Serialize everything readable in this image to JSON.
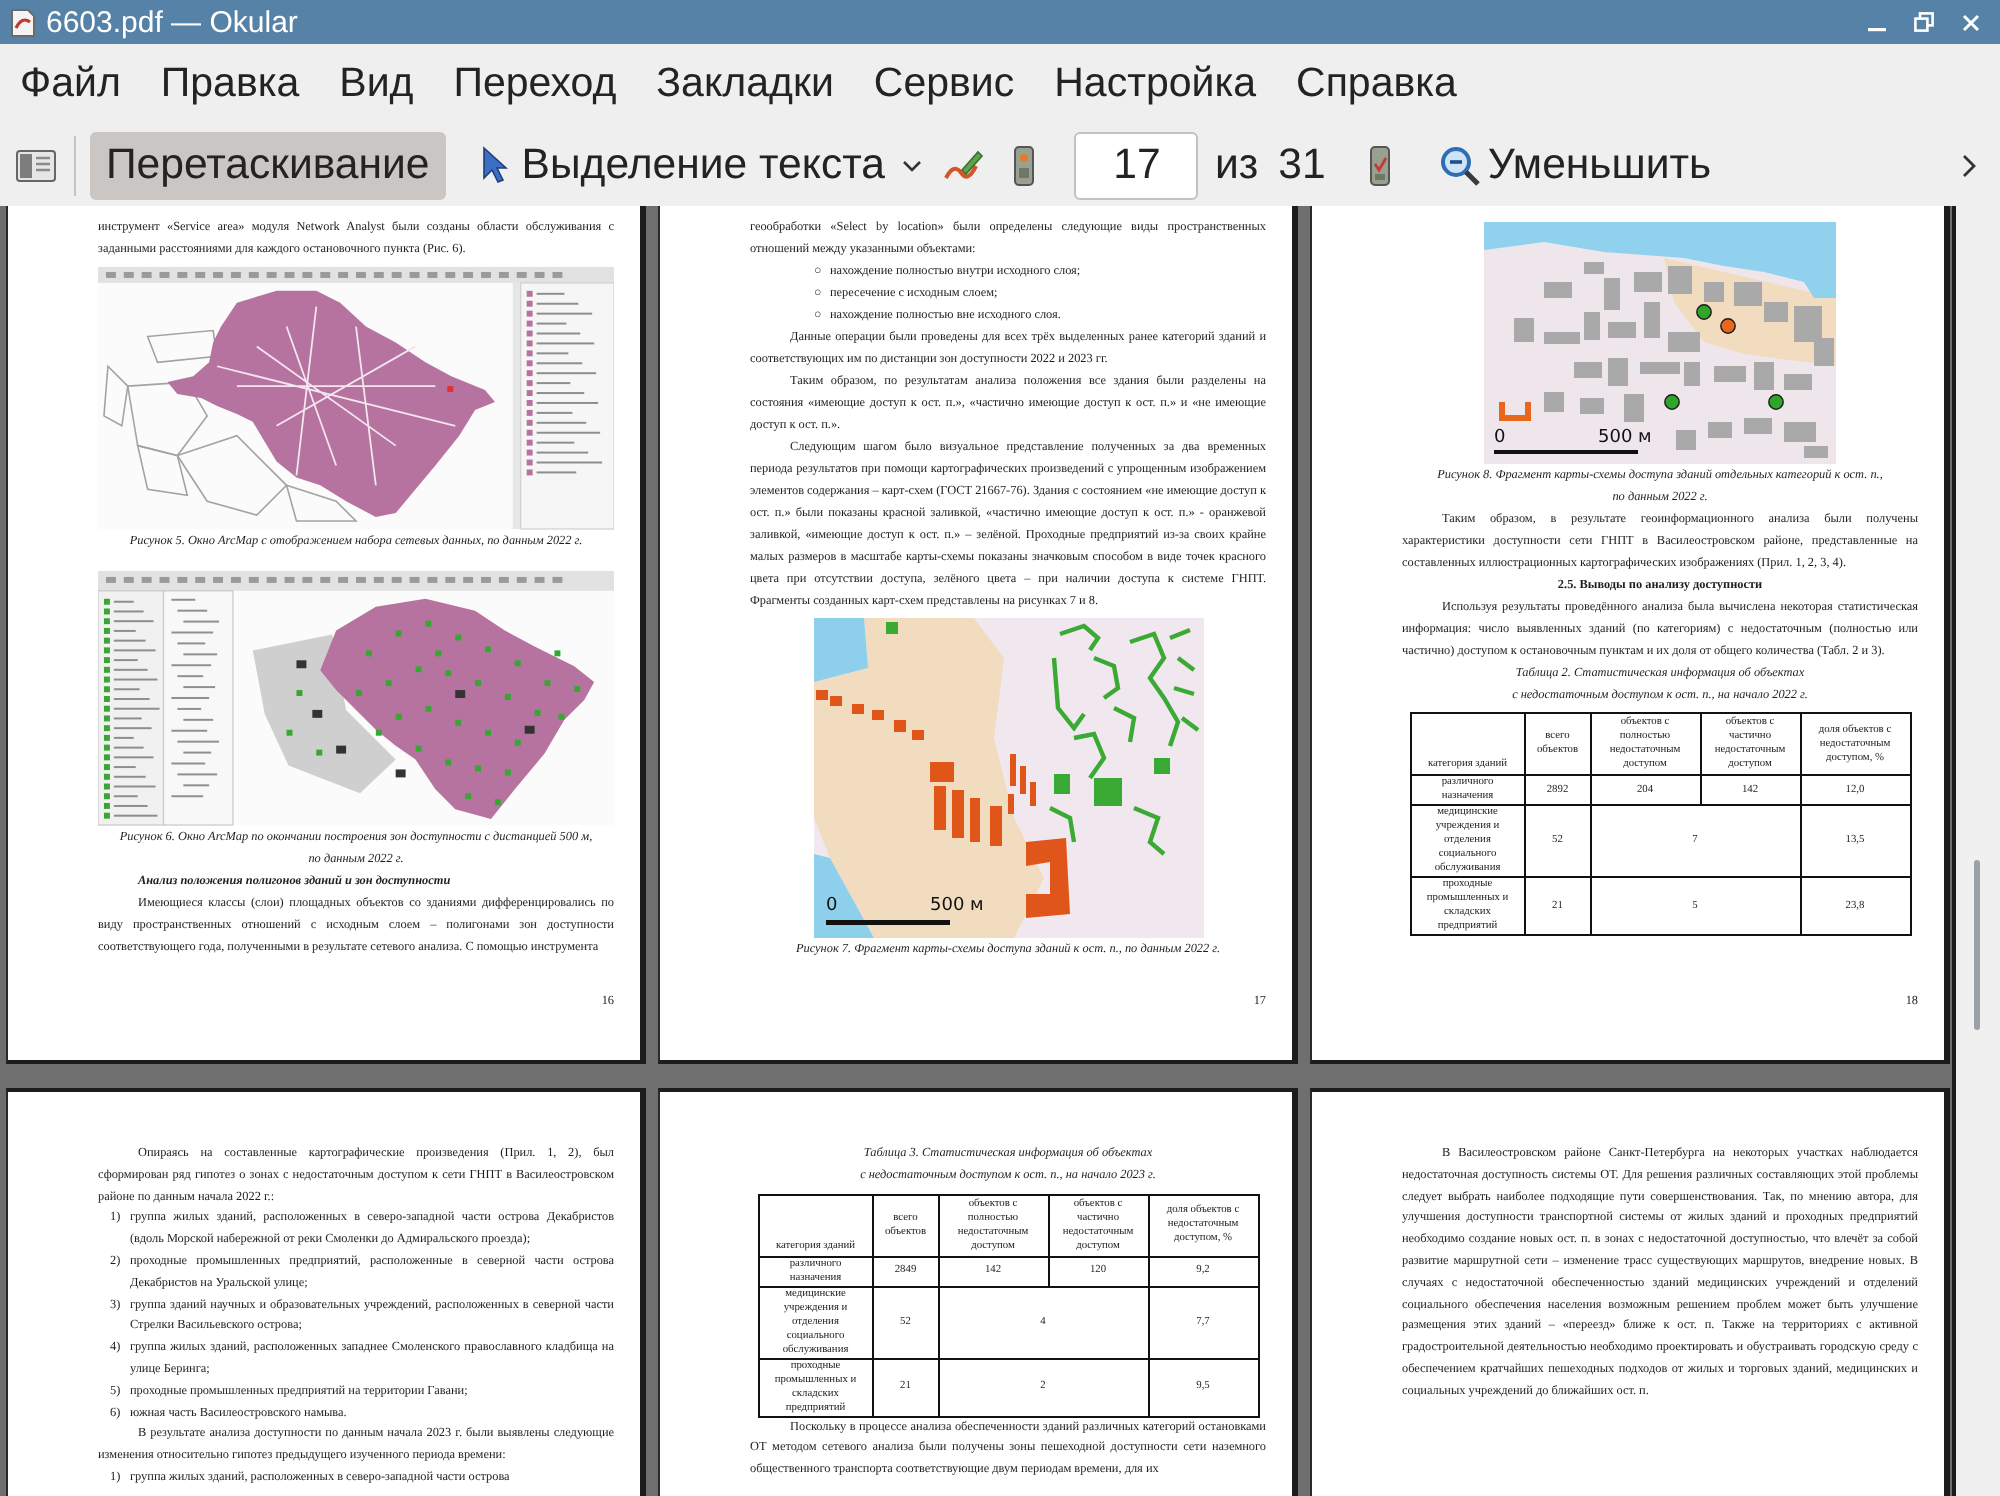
{
  "window": {
    "title": "6603.pdf — Okular"
  },
  "menu": [
    {
      "label": "Файл"
    },
    {
      "label": "Правка"
    },
    {
      "label": "Вид"
    },
    {
      "label": "Переход"
    },
    {
      "label": "Закладки"
    },
    {
      "label": "Сервис"
    },
    {
      "label": "Настройка"
    },
    {
      "label": "Справка"
    }
  ],
  "toolbar": {
    "tools": [
      {
        "label": "Перетаскивание",
        "selected": true
      },
      {
        "label": "Выделение текста",
        "selected": false
      }
    ],
    "page_field": {
      "value": "17"
    },
    "page_of": "из",
    "page_total": "31",
    "zoom_button": "Уменьшить"
  },
  "pages": [
    {
      "number": "16",
      "blocks": [
        {
          "kind": "paragraph",
          "continued": true,
          "text": "инструмент «Service area» модуля Network Analyst были созданы области обслуживания с заданными расстояниями для каждого остановочного пункта (Рис. 6)."
        },
        {
          "kind": "network_screen"
        },
        {
          "kind": "caption",
          "lines": [
            "Рисунок 5. Окно ArcMap с отображением набора сетевых данных, по данным 2022 г."
          ]
        },
        {
          "kind": "zones_screen"
        },
        {
          "kind": "caption",
          "lines": [
            "Рисунок 6. Окно ArcMap по окончании построения зон доступности с дистанцией 500 м,",
            "по данным 2022 г."
          ]
        },
        {
          "kind": "subheading",
          "text": "Анализ положения полигонов зданий и зон доступности"
        },
        {
          "kind": "paragraph",
          "continued": false,
          "text": "Имеющиеся классы (слои) площадных объектов со зданиями дифференцировались по виду пространственных отношений с исходным слоем – полигонами зон доступности соответствующего года, полученными в результате сетевого анализа. С помощью инструмента"
        }
      ]
    },
    {
      "number": "17",
      "blocks": [
        {
          "kind": "paragraph",
          "continued": true,
          "text": "геообработки «Select by location» были определены следующие виды пространственных отношений между указанными объектами:"
        },
        {
          "kind": "bullets",
          "items": [
            {
              "marker": "○",
              "text": "нахождение полностью внутри исходного слоя;"
            },
            {
              "marker": "○",
              "text": "пересечение с исходным слоем;"
            },
            {
              "marker": "○",
              "text": "нахождение полностью вне исходного слоя."
            }
          ]
        },
        {
          "kind": "paragraph",
          "continued": false,
          "text": "Данные операции были проведены для всех трёх выделенных ранее категорий зданий и соответствующих им по дистанции зон доступности 2022 и 2023 гг."
        },
        {
          "kind": "paragraph",
          "continued": false,
          "text": "Таким образом, по результатам анализа положения все здания были разделены на состояния «имеющие доступ к ост. п.», «частично имеющие доступ к ост. п.» и «не имеющие доступ к ост. п.»."
        },
        {
          "kind": "paragraph",
          "continued": false,
          "text": "Следующим шагом было визуальное представление полученных за два временных периода результатов при помощи картографических произведений с упрощенным изображением элементов содержания – карт-схем (ГОСТ 21667-76). Здания с состоянием «не имеющие доступ к ост. п.» были показаны красной заливкой, «частично имеющие доступ к ост. п.» - оранжевой заливкой, «имеющие доступ к ост. п.» – зелёной. Проходные предприятий из-за своих крайне малых размеров в масштабе карты-схемы показаны значковым способом в виде точек красного цвета при отсутствии доступа, зелёного цвета – при наличии доступа к системе ГНПТ. Фрагменты созданных карт-схем представлены на рисунках 7 и 8."
        },
        {
          "kind": "map_fragment",
          "scale": [
            "0",
            "500 м"
          ]
        },
        {
          "kind": "caption",
          "lines": [
            "Рисунок 7. Фрагмент карты-схемы доступа зданий к ост. п., по данным 2022 г."
          ]
        }
      ]
    },
    {
      "number": "18",
      "blocks": [
        {
          "kind": "poi_map",
          "scale": [
            "0",
            "500 м"
          ],
          "markers": [
            {
              "color": "#2fa52a"
            },
            {
              "color": "#e8671c"
            },
            {
              "color": "#2fa52a"
            },
            {
              "color": "#2fa52a"
            }
          ]
        },
        {
          "kind": "caption",
          "lines": [
            "Рисунок 8. Фрагмент карты-схемы доступа зданий отдельных категорий к ост. п.,",
            "по данным 2022 г."
          ]
        },
        {
          "kind": "paragraph",
          "continued": false,
          "text": "Таким образом, в результате геоинформационного анализа были получены характеристики доступности сети ГНПТ в Василеостровском районе, представленные на составленных иллюстрационных картографических изображениях (Прил. 1, 2, 3, 4)."
        },
        {
          "kind": "heading",
          "text": "2.5. Выводы по анализу доступности"
        },
        {
          "kind": "paragraph",
          "continued": false,
          "text": "Используя результаты проведённого анализа была вычислена некоторая статистическая информация: число выявленных зданий (по категориям) с недостаточным (полностью или частично) доступом к остановочным пунктам и их доля от общего количества (Табл. 2 и 3)."
        },
        {
          "kind": "caption",
          "lines": [
            "Таблица 2. Статистическая информация об объектах",
            "с недостаточным доступом к ост. п., на начало 2022 г."
          ]
        },
        {
          "kind": "table",
          "columns": [
            "категория зданий",
            "всего объектов",
            "объектов с полностью недостаточным доступом",
            "объектов с частично недостаточным доступом",
            "доля объектов с недостаточным доступом, %"
          ],
          "rows": [
            {
              "cells": [
                {
                  "text": "различного назначения"
                },
                {
                  "text": "2892"
                },
                {
                  "text": "204"
                },
                {
                  "text": "142"
                },
                {
                  "text": "12,0"
                }
              ]
            },
            {
              "cells": [
                {
                  "text": "медицинские учреждения и отделения социального обслуживания"
                },
                {
                  "text": "52"
                },
                {
                  "text": "7",
                  "colspan": 2
                },
                {
                  "text": "13,5"
                }
              ]
            },
            {
              "cells": [
                {
                  "text": "проходные промышленных и складских предприятий"
                },
                {
                  "text": "21"
                },
                {
                  "text": "5",
                  "colspan": 2
                },
                {
                  "text": "23,8"
                }
              ]
            }
          ]
        }
      ]
    },
    {
      "blocks": [
        {
          "kind": "paragraph",
          "continued": false,
          "text": "Опираясь на составленные картографические произведения (Прил. 1, 2), был сформирован ряд гипотез о зонах с недостаточным доступом к сети ГНПТ в Василеостровском районе по данным начала 2022 г.:"
        },
        {
          "kind": "numbered",
          "items": [
            {
              "marker": "1)",
              "text": "группа жилых зданий, расположенных в северо-западной части острова Декабристов (вдоль Морской набережной от реки Смоленки до Адмиральского проезда);"
            },
            {
              "marker": "2)",
              "text": "проходные промышленных предприятий, расположенные в северной части острова Декабристов на Уральской улице;"
            },
            {
              "marker": "3)",
              "text": "группа зданий научных и образовательных учреждений, расположенных в северной части Стрелки Васильевского острова;"
            },
            {
              "marker": "4)",
              "text": "группа жилых зданий, расположенных западнее Смоленского православного кладбища на улице Беринга;"
            },
            {
              "marker": "5)",
              "text": "проходные промышленных предприятий на территории Гавани;"
            },
            {
              "marker": "6)",
              "text": "южная часть Василеостровского намыва."
            }
          ]
        },
        {
          "kind": "paragraph",
          "continued": false,
          "text": "В результате анализа доступности по данным начала 2023 г. были выявлены следующие изменения относительно гипотез предыдущего изученного периода времени:"
        },
        {
          "kind": "numbered",
          "items": [
            {
              "marker": "1)",
              "text": "группа жилых зданий, расположенных в северо-западной части острова"
            }
          ]
        }
      ]
    },
    {
      "blocks": [
        {
          "kind": "caption",
          "lines": [
            "Таблица 3. Статистическая информация об объектах",
            "с недостаточным доступом к ост. п., на начало 2023 г."
          ]
        },
        {
          "kind": "table",
          "columns": [
            "категория зданий",
            "всего объектов",
            "объектов с полностью недостаточным доступом",
            "объектов с частично недостаточным доступом",
            "доля объектов с недостаточным доступом, %"
          ],
          "rows": [
            {
              "cells": [
                {
                  "text": "различного назначения"
                },
                {
                  "text": "2849"
                },
                {
                  "text": "142"
                },
                {
                  "text": "120"
                },
                {
                  "text": "9,2"
                }
              ]
            },
            {
              "cells": [
                {
                  "text": "медицинские учреждения и отделения социального обслуживания"
                },
                {
                  "text": "52"
                },
                {
                  "text": "4",
                  "colspan": 2
                },
                {
                  "text": "7,7"
                }
              ]
            },
            {
              "cells": [
                {
                  "text": "проходные промышленных и складских предприятий"
                },
                {
                  "text": "21"
                },
                {
                  "text": "2",
                  "colspan": 2
                },
                {
                  "text": "9,5"
                }
              ]
            }
          ]
        },
        {
          "kind": "paragraph",
          "continued": false,
          "text": "Поскольку в процессе анализа обеспеченности зданий различных категорий остановками ОТ методом сетевого анализа были получены зоны пешеходной доступности сети наземного общественного транспорта соответствующие двум периодам времени, для их"
        }
      ]
    },
    {
      "blocks": [
        {
          "kind": "paragraph",
          "continued": false,
          "text": "В Василеостровском районе Санкт-Петербурга на некоторых участках наблюдается недостаточная доступность системы ОТ. Для решения различных составляющих этой проблемы следует выбрать наиболее подходящие пути совершенствования. Так, по мнению автора, для улучшения доступности транспортной системы от жилых зданий и проходных предприятий необходимо создание новых ост. п. в зонах с недостаточной доступностью, что влечёт за собой развитие маршрутной сети – изменение трасс существующих маршрутов, внедрение новых. В случаях с недостаточной обеспеченностью зданий медицинских учреждений и отделений социального обеспечения населения возможным решением проблем может быть улучшение размещения этих зданий – «переезд» ближе к ост. п. Также на территориях с активной градостроительной деятельностью необходимо проектировать и обустраивать городскую среду с обеспечением кратчайших пешеходных подходов от жилых и торговых зданий, медицинских и социальных учреждений до ближайших ост. п."
        }
      ]
    }
  ]
}
